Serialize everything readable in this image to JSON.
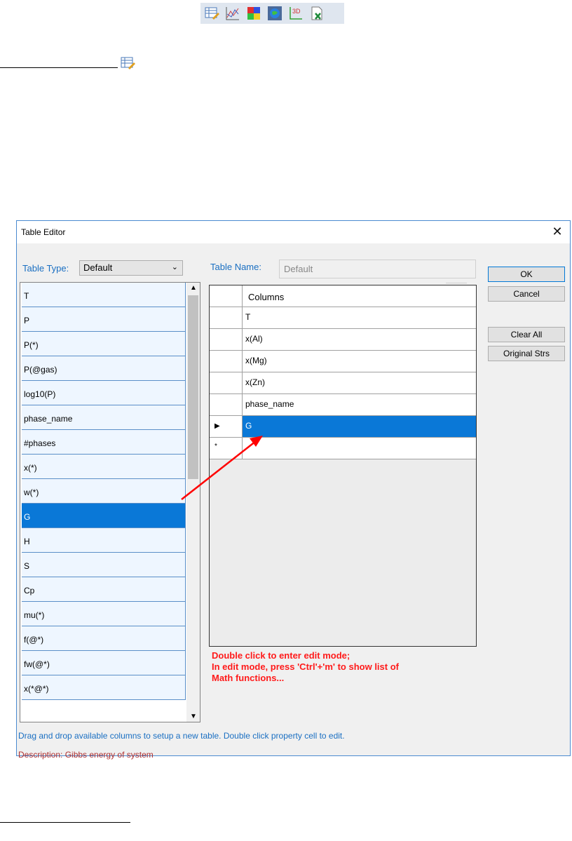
{
  "toolbar": {
    "icons": [
      "table-editor-icon",
      "line-chart-icon",
      "color-grid-icon",
      "globe-icon",
      "3d-plot-icon",
      "excel-export-icon"
    ],
    "label_3d": "3D"
  },
  "dialog": {
    "title": "Table Editor",
    "close_glyph": "✕",
    "table_type_label": "Table Type:",
    "table_type_value": "Default",
    "table_name_label": "Table Name:",
    "table_name_value": "Default",
    "available_columns": [
      "T",
      "P",
      "P(*)",
      "P(@gas)",
      "log10(P)",
      "phase_name",
      "#phases",
      "x(*)",
      "w(*)",
      "G",
      "H",
      "S",
      "Cp",
      "mu(*)",
      "f(@*)",
      "fw(@*)",
      "x(*@*)"
    ],
    "selected_available": "G",
    "grid_header": "Columns",
    "grid_rows": [
      "T",
      "x(Al)",
      "x(Mg)",
      "x(Zn)",
      "phase_name",
      "G",
      ""
    ],
    "current_row_glyph": "▶",
    "new_row_glyph": "*",
    "buttons": {
      "ok": "OK",
      "cancel": "Cancel",
      "clear_all": "Clear All",
      "original_strs": "Original Strs"
    },
    "hint_lines": [
      "Double click to enter edit mode;",
      "In edit mode, press 'Ctrl'+'m' to show list of",
      "Math functions..."
    ],
    "footer_help": "Drag and drop available columns to setup a new table. Double click property cell to edit.",
    "footer_description": "Description: Gibbs energy of system"
  },
  "colors": {
    "selection": "#0a78d7",
    "accent_blue": "#1a6fc2",
    "hint_red": "#ff1a1a",
    "desc_red": "#b03030",
    "arrow_red": "#ff0000"
  }
}
